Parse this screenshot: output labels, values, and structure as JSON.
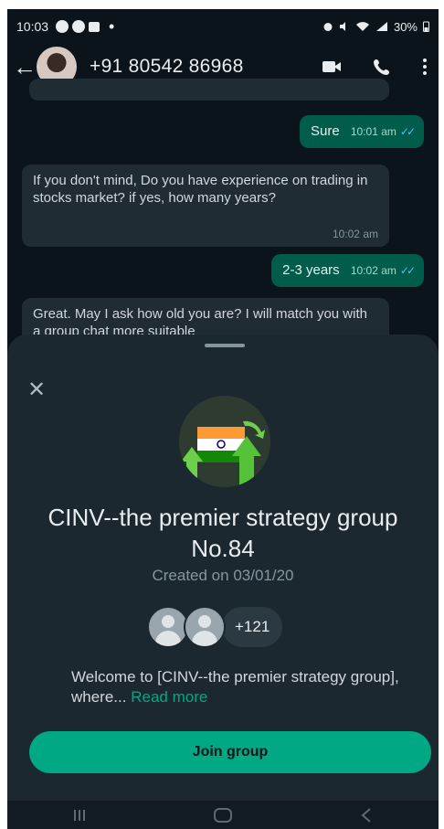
{
  "status_bar": {
    "time": "10:03",
    "indicators": "30%"
  },
  "header": {
    "contact_name": "+91 80542 86968"
  },
  "messages": [
    {
      "direction": "outgoing",
      "text": "Sure",
      "time": "10:01 am"
    },
    {
      "direction": "incoming",
      "text": "If you don't mind, Do you have experience on trading in stocks market? if yes, how many years?",
      "time": "10:02 am"
    },
    {
      "direction": "outgoing",
      "text": "2-3 years",
      "time": "10:02 am"
    },
    {
      "direction": "incoming",
      "text": "Great. May I ask how old you are? I will match you with a group chat more suitable"
    }
  ],
  "group_sheet": {
    "title": "CINV--the premier strategy group No.84",
    "created": "Created on 03/01/20",
    "member_count": "+121",
    "description": "Welcome to [CINV--the premier strategy group], where...",
    "read_more": "Read more",
    "join_label": "Join group"
  },
  "colors": {
    "background": "#0b141a",
    "sheet": "#1c2830",
    "accent": "#00a884",
    "outgoing_bubble": "#005c4b"
  },
  "icons": [
    "back-arrow-icon",
    "video-call-icon",
    "voice-call-icon",
    "more-options-icon",
    "close-icon",
    "recent-apps-icon",
    "home-icon",
    "nav-back-icon"
  ]
}
